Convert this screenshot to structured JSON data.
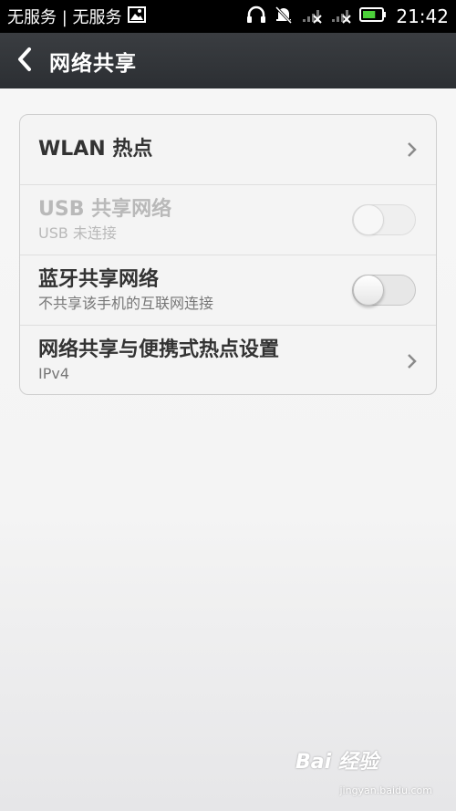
{
  "status_bar": {
    "carrier": "无服务 | 无服务",
    "time": "21:42",
    "battery_level_fraction": 0.7,
    "icons": [
      "image-notification-icon",
      "headphones-icon",
      "vibrate-mute-icon",
      "signal-none-icon",
      "signal-none-icon",
      "battery-icon"
    ]
  },
  "header": {
    "back_icon": "back-arrow-icon",
    "title": "网络共享"
  },
  "settings": {
    "items": [
      {
        "title": "WLAN 热点",
        "subtitle": "",
        "control": "chevron",
        "enabled": true
      },
      {
        "title": "USB 共享网络",
        "subtitle": "USB 未连接",
        "control": "toggle",
        "checked": false,
        "enabled": false
      },
      {
        "title": "蓝牙共享网络",
        "subtitle": "不共享该手机的互联网连接",
        "control": "toggle",
        "checked": false,
        "enabled": true
      },
      {
        "title": "网络共享与便携式热点设置",
        "subtitle": "IPv4",
        "control": "chevron",
        "enabled": true
      }
    ]
  },
  "watermark": {
    "logo": "Bai 经验",
    "url": "jingyan.baidu.com"
  },
  "colors": {
    "status_bar_bg": "#000000",
    "title_bar_bg": "#2f3236",
    "battery_green": "#4cd13a",
    "card_bg": "#f4f4f4"
  }
}
